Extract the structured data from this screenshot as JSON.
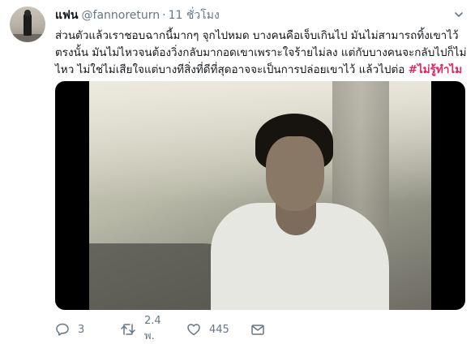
{
  "tweet": {
    "author_name": "แฟน",
    "author_handle": "@fannoreturn",
    "separator": "·",
    "timestamp": "11 ชั่วโมง",
    "text_lines": [
      "ส่วนตัวแล้วเราชอบฉากนี้มากๆ จุกไปหมด บางคนคือเจ็บเกินไป มันไม่สามารถทิ้งเขาไว้",
      "ตรงนั้น มันไม่ไหวจนต้องวิ่งกลับมากอดเขาเพราะใจร้ายไม่ลง แต่กับบางคนจะกลับไปก็ไม่",
      "ไหว ไม่ใช่ไม่เสียใจแต่บางทีสิ่งที่ดีที่สุดอาจจะเป็นการปล่อยเขาไว้ แล้วไปต่อ "
    ],
    "hashtag": "#ไม่รู้ทำไม",
    "media_icon": "video-frame",
    "menu_icon": "chevron-down-icon"
  },
  "actions": {
    "reply_count": "3",
    "retweet_count": "2.4 พ.",
    "like_count": "445"
  },
  "colors": {
    "hashtag": "#e0245e",
    "meta": "#657786",
    "text": "#14171a"
  }
}
